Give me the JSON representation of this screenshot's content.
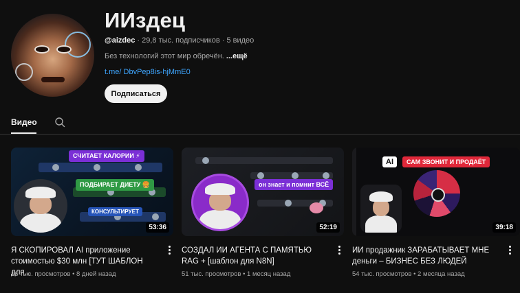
{
  "channel": {
    "title": "ИИздец",
    "handle": "@aizdec",
    "stats": "· 29,8 тыс. подписчиков · 5 видео",
    "description": "Без технологий этот мир обречён.",
    "more_label": "...ещё",
    "link": "t.me/ DbvPep8is-hjMmE0",
    "subscribe_label": "Подписаться"
  },
  "tabs": {
    "videos_label": "Видео"
  },
  "videos": [
    {
      "title": "Я СКОПИРОВАЛ AI приложение стоимостью $30 млн [ТУТ ШАБЛОН для...",
      "meta": "16 тыс. просмотров • 8 дней назад",
      "duration": "53:36",
      "tags": [
        "СЧИТАЕТ КАЛОРИИ ⚡",
        "ПОДБИРАЕТ ДИЕТУ 🍔",
        "КОНСУЛЬТИРУЕТ"
      ]
    },
    {
      "title": "СОЗДАЛ ИИ АГЕНТА С ПАМЯТЬЮ RAG + [шаблон для N8N]",
      "meta": "51 тыс. просмотров • 1 месяц назад",
      "duration": "52:19",
      "tags": [
        "он знает и помнит ВСЁ"
      ]
    },
    {
      "title": "ИИ продажник ЗАРАБАТЫВАЕТ МНЕ деньги – БИЗНЕС БЕЗ ЛЮДЕЙ",
      "meta": "54 тыс. просмотров • 2 месяца назад",
      "duration": "39:18",
      "tags": [
        "AI",
        "САМ ЗВОНИТ И ПРОДАЁТ"
      ]
    }
  ],
  "colors": {
    "background": "#0f0f0f",
    "link": "#3ea6ff",
    "subscribe_bg": "#f1f1f1"
  }
}
